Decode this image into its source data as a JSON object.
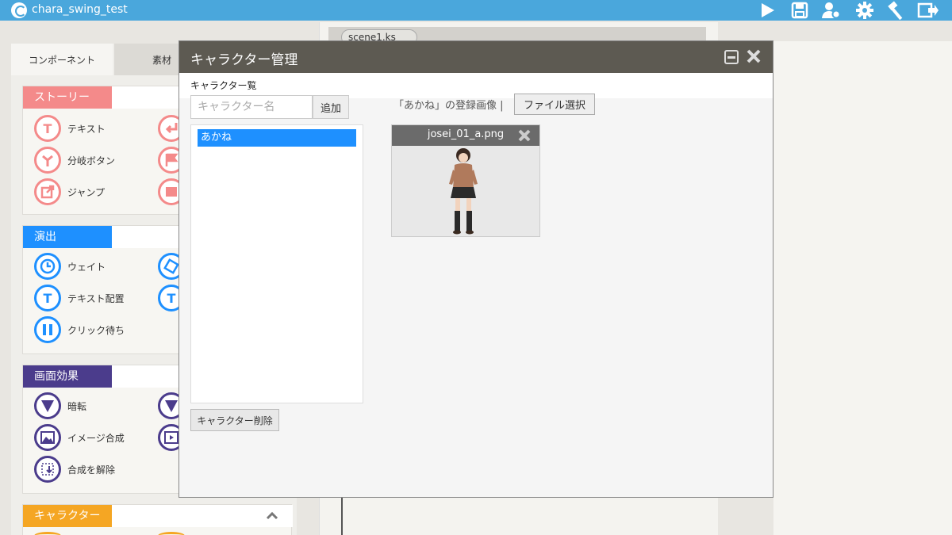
{
  "app": {
    "title": "chara_swing_test"
  },
  "toolbar": {
    "icons": [
      "play-icon",
      "save-icon",
      "user-settings-icon",
      "gear-icon",
      "build-icon",
      "exit-icon"
    ]
  },
  "left_tabs": {
    "active": "コンポーネント",
    "inactive": "素材"
  },
  "sections": {
    "story": {
      "label": "ストーリー",
      "color": "#f48a8a",
      "items": [
        "テキスト",
        "分岐ボタン",
        "ジャンプ"
      ]
    },
    "effects": {
      "label": "演出",
      "color": "#1e90ff",
      "items": [
        "ウェイト",
        "テキスト配置",
        "クリック待ち"
      ]
    },
    "screen": {
      "label": "画面効果",
      "color": "#4b3c8c",
      "items": [
        "暗転",
        "イメージ合成",
        "合成を解除"
      ]
    },
    "character": {
      "label": "キャラクター",
      "color": "#f5a623"
    }
  },
  "editor": {
    "tab_label": "scene1.ks"
  },
  "modal": {
    "title": "キャラクター管理",
    "list_caption": "キャラクター覧",
    "name_placeholder": "キャラクター名",
    "add_label": "追加",
    "characters": [
      "あかね"
    ],
    "delete_label": "キャラクター削除",
    "registered_label": "「あかね」の登録画像 |",
    "file_select_label": "ファイル選択",
    "image": {
      "filename": "josei_01_a.png"
    }
  }
}
